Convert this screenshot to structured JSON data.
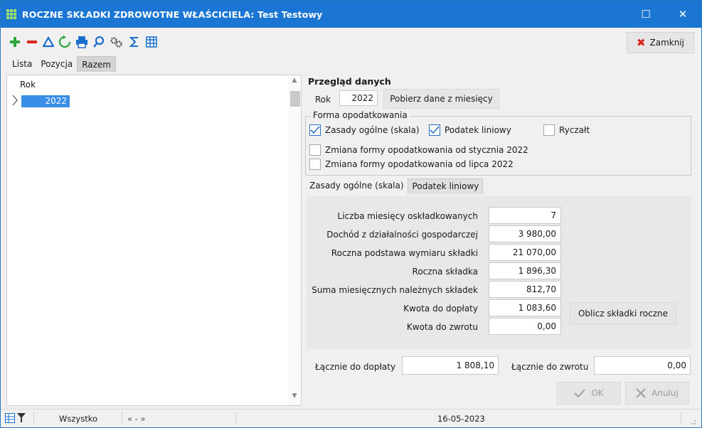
{
  "window": {
    "title": "ROCZNE SKŁADKI ZDROWOTNE WŁAŚCICIELA: Test Testowy",
    "maximize_glyph": "☐",
    "close_glyph": "✕"
  },
  "toolbar": {
    "icons": [
      "plus-icon",
      "minus-icon",
      "triangle-icon",
      "refresh-icon",
      "printer-icon",
      "search-icon",
      "settings-icon",
      "sum-icon",
      "columns-icon"
    ],
    "close_label": "Zamknij"
  },
  "tabs": [
    "Lista",
    "Pozycja",
    "Razem"
  ],
  "active_tab": "Razem",
  "list": {
    "header": "Rok",
    "rows": [
      "2022"
    ]
  },
  "overview": {
    "title": "Przegląd danych",
    "rok_label": "Rok",
    "rok_value": "2022",
    "fetch_button": "Pobierz dane z miesięcy",
    "forma_group": "Forma opodatkowania",
    "options": [
      {
        "label": "Zasady ogólne (skala)",
        "checked": true
      },
      {
        "label": "Podatek liniowy",
        "checked": true
      },
      {
        "label": "Ryczałt",
        "checked": false
      }
    ],
    "changes": [
      {
        "label": "Zmiana formy opodatkowania od stycznia 2022",
        "checked": false
      },
      {
        "label": "Zmiana formy opodatkowania od lipca 2022",
        "checked": false
      }
    ]
  },
  "subtabs": [
    "Zasady ogólne (skala)",
    "Podatek liniowy"
  ],
  "active_subtab": "Podatek liniowy",
  "details": [
    {
      "label": "Liczba miesięcy oskładkowanych",
      "value": "7"
    },
    {
      "label": "Dochód z działalności gospodarczej",
      "value": "3 980,00"
    },
    {
      "label": "Roczna podstawa wymiaru składki",
      "value": "21 070,00"
    },
    {
      "label": "Roczna składka",
      "value": "1 896,30"
    },
    {
      "label": "Suma miesięcznych należnych składek",
      "value": "812,70"
    },
    {
      "label": "Kwota do dopłaty",
      "value": "1 083,60"
    },
    {
      "label": "Kwota do zwrotu",
      "value": "0,00"
    }
  ],
  "calc_button": "Oblicz składki roczne",
  "totals": {
    "doplaty_label": "Łącznie do dopłaty",
    "doplaty_value": "1 808,10",
    "zwrotu_label": "Łącznie do zwrotu",
    "zwrotu_value": "0,00"
  },
  "actions": {
    "ok": "OK",
    "cancel": "Anuluj"
  },
  "status": {
    "filter": "Wszystko",
    "nav": "« - »",
    "date": "16-05-2023"
  },
  "colors": {
    "titlebar": "#1a76d2",
    "selection": "#3a8ee6",
    "check": "#2a6fc4",
    "close_x": "#d9261c"
  }
}
